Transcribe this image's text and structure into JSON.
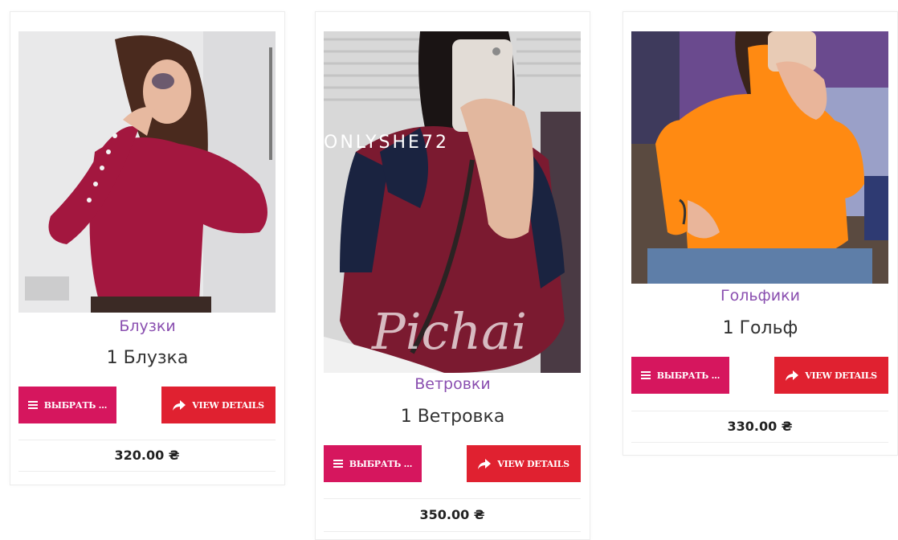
{
  "products": [
    {
      "category": "Блузки",
      "name": "1 Блузка",
      "choose_label": "ВЫБРАТЬ ...",
      "details_label": "VIEW DETAILS",
      "price": "320.00 ₴",
      "photo_colors": {
        "garment": "#a3173f",
        "background": "#e9e9ea"
      }
    },
    {
      "category": "Ветровки",
      "name": "1 Ветровка",
      "choose_label": "ВЫБРАТЬ ...",
      "details_label": "VIEW DETAILS",
      "price": "350.00 ₴",
      "photo_overlay_text": "ONLYSHE72",
      "photo_colors": {
        "garment": "#7b1a30",
        "trim": "#1a2340",
        "background": "#d8d8d8"
      }
    },
    {
      "category": "Гольфики",
      "name": "1 Гольф",
      "choose_label": "ВЫБРАТЬ ...",
      "details_label": "VIEW DETAILS",
      "price": "330.00 ₴",
      "photo_colors": {
        "garment": "#ff8a12",
        "background": "#6a4a8e"
      }
    }
  ],
  "colors": {
    "choose_button": "#d6165e",
    "details_button": "#e02130",
    "category_text": "#8a4fb0"
  },
  "icons": {
    "choose": "menu-lines-icon",
    "details": "share-arrow-icon"
  }
}
